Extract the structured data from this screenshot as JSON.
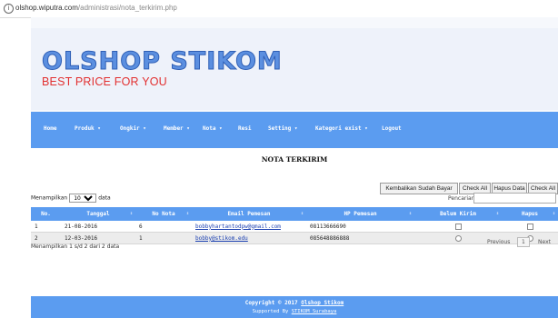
{
  "browser": {
    "url_host": "olshop.wiputra.com",
    "url_path": "/administrasi/nota_terkirim.php"
  },
  "header": {
    "logo": "OLSHOP STIKOM",
    "tagline": "BEST PRICE FOR YOU"
  },
  "nav": {
    "items": [
      {
        "label": "Home"
      },
      {
        "label": "Produk ▾"
      },
      {
        "label": "Ongkir ▾"
      },
      {
        "label": "Member ▾"
      },
      {
        "label": "Nota ▾"
      },
      {
        "label": "Resi"
      },
      {
        "label": "Setting ▾"
      },
      {
        "label": "Kategori exist ▾"
      },
      {
        "label": "Logout"
      }
    ]
  },
  "page_title": "NOTA TERKIRIM",
  "actions": {
    "kembalikan": "Kembalikan Sudah Bayar",
    "check_all_1": "Check All",
    "hapus_data": "Hapus Data",
    "check_all_2": "Check All"
  },
  "table_controls": {
    "length_prefix": "Menampilkan",
    "length_value": "10",
    "length_suffix": "data",
    "search_label": "Pencarian:",
    "search_value": ""
  },
  "table": {
    "columns": [
      "No.",
      "Tanggal",
      "No Nota",
      "Email Pemesan",
      "HP Pemesan",
      "Belum Kirim",
      "Hapus"
    ],
    "rows": [
      {
        "no": "1",
        "tanggal": "21-08-2016",
        "no_nota": "6",
        "email": "bobbyhartantodpw@gmail.com",
        "hp": "08113666690"
      },
      {
        "no": "2",
        "tanggal": "12-03-2016",
        "no_nota": "1",
        "email": "bobby@stikom.edu",
        "hp": "085648886888"
      }
    ],
    "info": "Menampilkan 1 s/d 2 dari 2 data",
    "pagination": {
      "previous": "Previous",
      "current": "1",
      "next": "Next"
    }
  },
  "footer": {
    "copyright_prefix": "Copyright © 2017",
    "copyright_link": "Olshop Stikom",
    "supported_prefix": "Supported By",
    "supported_link": "STIKOM Surabaya"
  },
  "colors": {
    "nav_blue": "#5b9cf0",
    "logo_blue": "#5b8fe0",
    "tagline_red": "#e23030",
    "link_blue": "#1a3fb0"
  }
}
